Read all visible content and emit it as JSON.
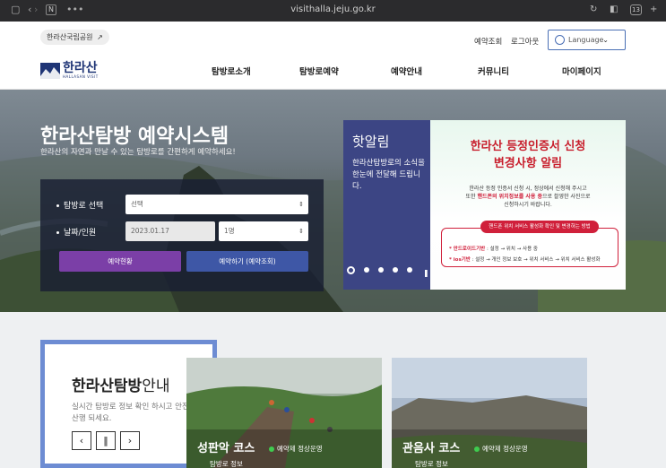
{
  "browser": {
    "url": "visithalla.jeju.go.kr",
    "tab_count": "13",
    "tab_icon": "N"
  },
  "header": {
    "national_park_button": "한라산국립공원",
    "reservation_check": "예약조회",
    "logout": "로그아웃",
    "language": "Language",
    "logo_text": "한라산",
    "logo_subtext": "HALLASAN VISIT",
    "menu": [
      "탐방로소개",
      "탐방로예약",
      "예약안내",
      "커뮤니티",
      "마이페이지"
    ]
  },
  "hero": {
    "title": "한라산탐방 예약시스템",
    "subtitle": "한라산의 자연과 만날 수 있는 탐방로를 간편하게 예약하세요!",
    "form": {
      "trail_label": "탐방로 선택",
      "trail_value": "선택",
      "date_label": "날짜/인원",
      "date_value": "2023.01.17",
      "people_value": "1명",
      "status_button": "예약현황",
      "reserve_button": "예약하기 (예약조회)"
    },
    "notice": {
      "title": "핫알림",
      "desc": "한라산탐방로의 소식을 한눈에 전달해 드립니다.",
      "pages": 5,
      "active_page": 1
    },
    "banner": {
      "title_line1": "한라산 등정인증서 신청",
      "title_line2": "변경사항 알림",
      "text_line1": "한라산 등정 인증서 신청 시, 정상에서 신청해 주시고",
      "text_line2_pre": "또한 ",
      "text_line2_red": "핸드폰의 위치정보를 사용 중",
      "text_line2_post": "으로 촬영한 사진으로",
      "text_line3": "신청하시기 바랍니다.",
      "pill": "핸드폰 위치 서비스 활성화 확인 및 변경하는 방법",
      "android_label": "* 안드로이드기반",
      "android_text": ": 설정 → 위치 → 사용 중",
      "ios_label": "* ios기반",
      "ios_text": ": 설정 → 개인 정보 보호 → 위치 서비스 → 위치 서비스 활성화"
    }
  },
  "guide": {
    "title_bold": "한라산탐방",
    "title_rest": "안내",
    "desc": "실시간 탐방로 정보 확인 하시고 안전한 산행 되세요.",
    "prev": "‹",
    "pause": "‖",
    "next": "›"
  },
  "courses": [
    {
      "name": "성판악 코스",
      "status": "예약제 정상운영",
      "more": "탐방로 정보"
    },
    {
      "name": "관음사 코스",
      "status": "예약제 정상운영",
      "more": "탐방로 정보"
    }
  ]
}
